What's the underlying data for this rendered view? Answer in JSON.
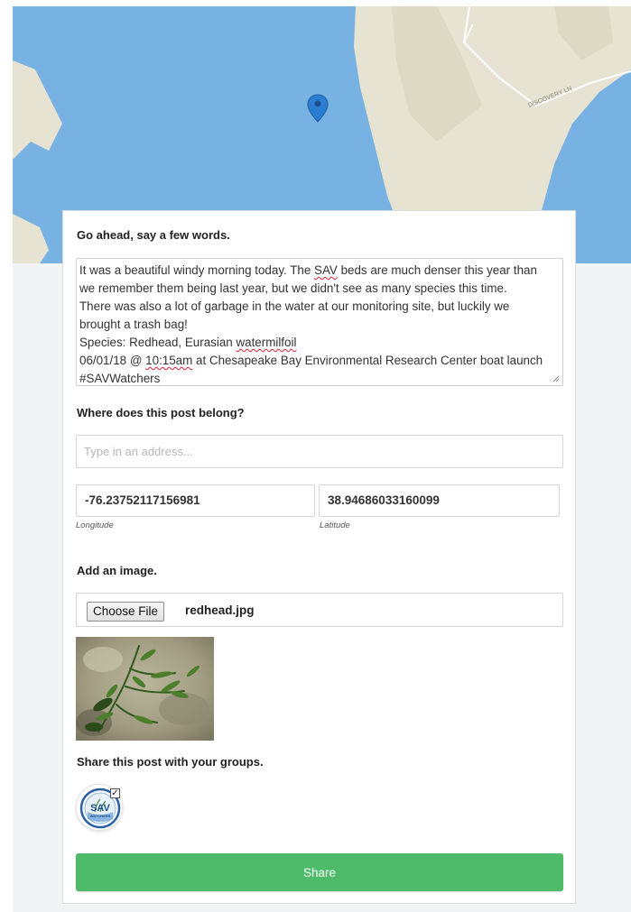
{
  "map": {
    "road_label": "DISCOVERY LN",
    "colors": {
      "water": "#78b2e2",
      "land": "#e6e3d3",
      "marker": "#2a7dd1"
    }
  },
  "compose": {
    "prompt_label": "Go ahead, say a few words.",
    "lines": [
      "It was a beautiful windy morning today. The ",
      "SAV",
      " beds are much denser this year than",
      "we remember them being last year, but we didn't see as many species this time.",
      "There was also a lot of garbage in the water at our monitoring site, but luckily we",
      "brought a trash bag!",
      "Species: Redhead, Eurasian ",
      "watermilfoil",
      "06/01/18 @ ",
      "10:15am",
      " at Chesapeake Bay Environmental Research Center boat launch",
      "#SAVWatchers"
    ]
  },
  "location": {
    "label": "Where does this post belong?",
    "address_placeholder": "Type in an address...",
    "longitude_value": "-76.23752117156981",
    "longitude_caption": "Longitude",
    "latitude_value": "38.94686033160099",
    "latitude_caption": "Latitude"
  },
  "image": {
    "label": "Add an image.",
    "choose_button": "Choose File",
    "file_name": "redhead.jpg"
  },
  "groups": {
    "label": "Share this post with your groups.",
    "group_badge_text": "SAV",
    "group_badge_subtext": "WATCHERS"
  },
  "actions": {
    "share_label": "Share",
    "share_color": "#4dbb6a"
  }
}
